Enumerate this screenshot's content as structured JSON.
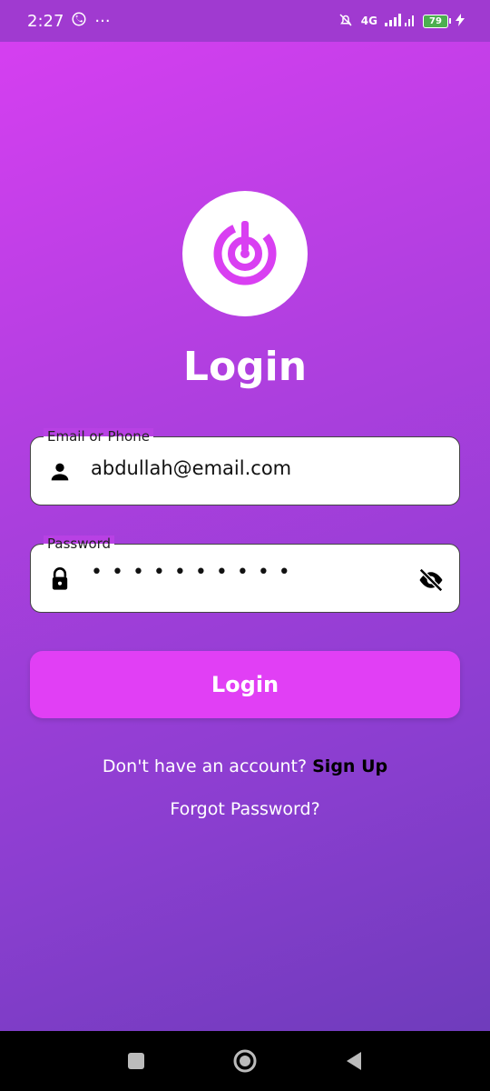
{
  "status_bar": {
    "time": "2:27",
    "more": "···",
    "network": "4G",
    "battery": "79"
  },
  "screen": {
    "title": "Login"
  },
  "email_field": {
    "label": "Email or Phone",
    "value": "abdullah@email.com"
  },
  "password_field": {
    "label": "Password",
    "value": "••••••••••"
  },
  "login_button": {
    "label": "Login"
  },
  "signup": {
    "prompt": "Don't have an account?",
    "link": "Sign Up"
  },
  "forgot": {
    "label": "Forgot Password?"
  },
  "colors": {
    "accent": "#e13ff5",
    "gradient_top": "#d93ff2",
    "gradient_bottom": "#6a3bb8"
  },
  "icons": [
    "whatsapp-icon",
    "mute-icon",
    "signal-icon",
    "battery-icon",
    "charging-icon",
    "app-logo-icon",
    "person-icon",
    "lock-icon",
    "eye-off-icon",
    "recents-icon",
    "home-icon",
    "back-icon"
  ]
}
